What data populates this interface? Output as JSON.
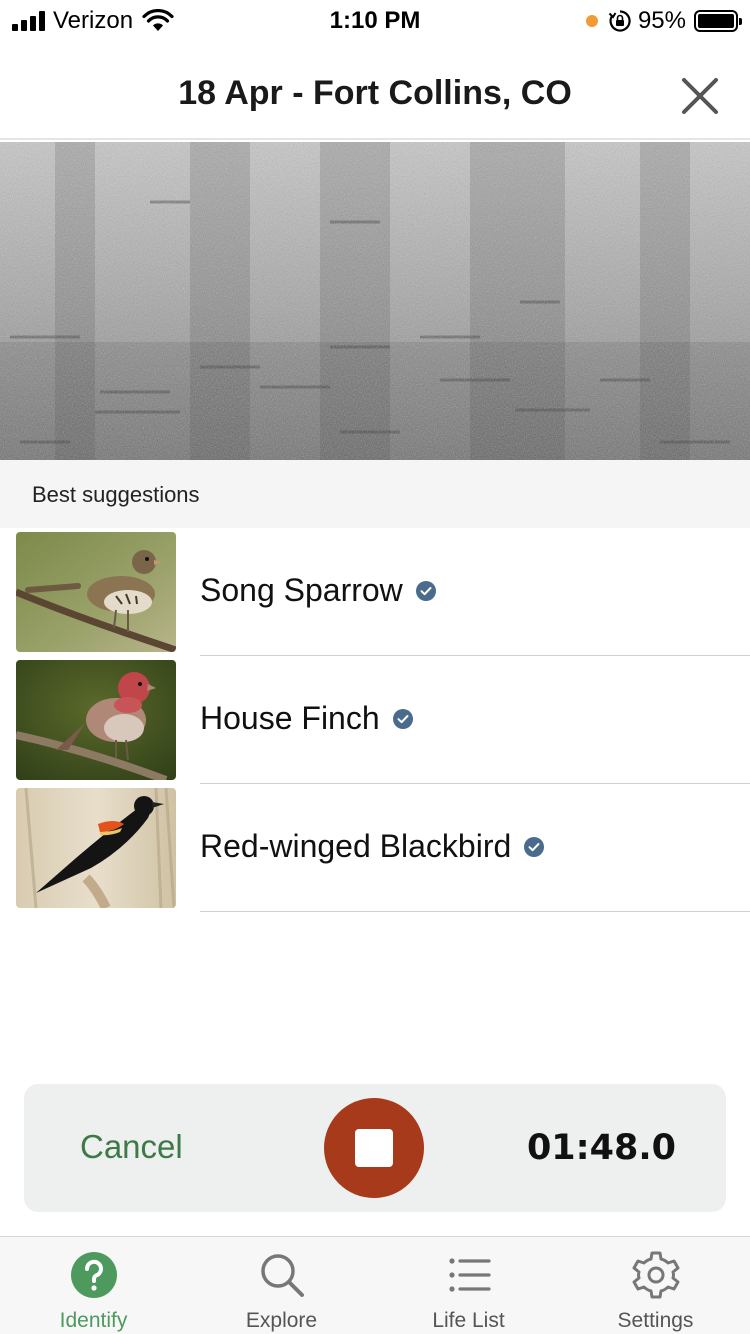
{
  "status_bar": {
    "carrier": "Verizon",
    "time": "1:10 PM",
    "battery_percent": "95%"
  },
  "header": {
    "title": "18 Apr - Fort Collins, CO"
  },
  "suggestions": {
    "section_title": "Best suggestions",
    "items": [
      {
        "label": "Song Sparrow"
      },
      {
        "label": "House Finch"
      },
      {
        "label": "Red-winged Blackbird"
      }
    ]
  },
  "recorder": {
    "cancel_label": "Cancel",
    "elapsed": "01:48.0"
  },
  "tab_bar": {
    "tabs": [
      {
        "label": "Identify",
        "icon": "question-circle-icon",
        "active": true
      },
      {
        "label": "Explore",
        "icon": "search-icon",
        "active": false
      },
      {
        "label": "Life List",
        "icon": "list-icon",
        "active": false
      },
      {
        "label": "Settings",
        "icon": "gear-icon",
        "active": false
      }
    ]
  },
  "colors": {
    "accent_green": "#4e9a5e",
    "stop_button": "#a83a1c",
    "verified_badge": "#4b6b8c",
    "recorder_bg": "#edf0ee"
  }
}
